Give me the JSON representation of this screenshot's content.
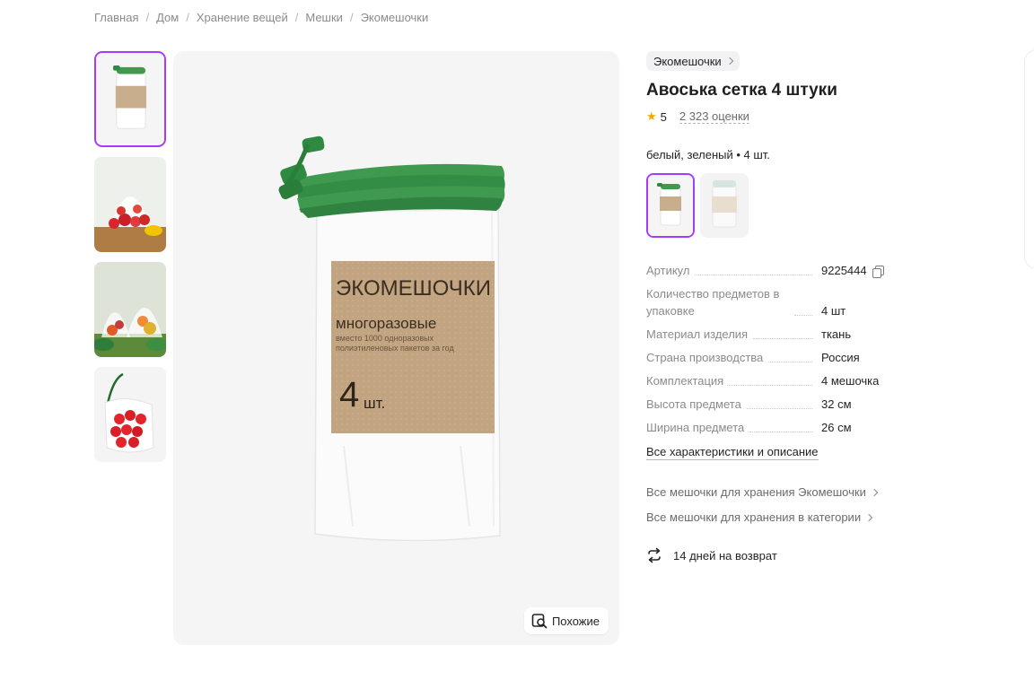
{
  "breadcrumb": [
    "Главная",
    "Дом",
    "Хранение вещей",
    "Мешки",
    "Экомешочки"
  ],
  "breadcrumb_separator": "/",
  "product": {
    "brand": "Экомешочки",
    "title": "Авоська сетка 4 штуки",
    "rating": "5",
    "reviews": "2 323 оценки",
    "variant_label": "белый, зеленый • 4 шт.",
    "image_label": {
      "brand": "ЭКОМЕШОЧКИ",
      "sub": "многоразовые",
      "small1": "вместо 1000 одноразовых",
      "small2": "полиэтиленовых пакетов за год",
      "count": "4",
      "unit": "шт."
    }
  },
  "similar_button": "Похожие",
  "specs": [
    {
      "key": "Артикул",
      "value": "9225444",
      "copy": true
    },
    {
      "key": "Количество предметов в упаковке",
      "value": "4 шт"
    },
    {
      "key": "Материал изделия",
      "value": "ткань"
    },
    {
      "key": "Страна производства",
      "value": "Россия"
    },
    {
      "key": "Комплектация",
      "value": "4 мешочка"
    },
    {
      "key": "Высота предмета",
      "value": "32 см"
    },
    {
      "key": "Ширина предмета",
      "value": "26 см"
    }
  ],
  "all_characteristics": "Все характеристики и описание",
  "links": [
    "Все мешочки для хранения Экомешочки",
    "Все мешочки для хранения в категории"
  ],
  "return_policy": "14 дней на возврат",
  "colors": {
    "accent": "#a73afd",
    "star": "#f6a700",
    "drawstring": "#3f9a4f"
  },
  "icons": [
    "star-icon",
    "copy-icon",
    "chevron-right-icon",
    "return-arrows-icon",
    "similar-search-icon"
  ]
}
